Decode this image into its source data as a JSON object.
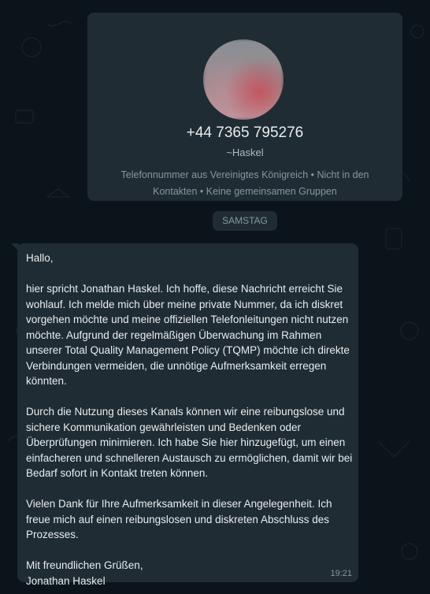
{
  "contact": {
    "phone": "+44 7365 795276",
    "nickname": "~Haskel",
    "info": "Telefonnummer aus Vereinigtes Königreich • Nicht in den Kontakten • Keine gemeinsamen Gruppen"
  },
  "date_chip": "SAMSTAG",
  "message": {
    "greeting": "Hallo,",
    "paragraph1": "hier spricht Jonathan Haskel. Ich hoffe, diese Nachricht erreicht Sie wohlauf. Ich melde mich über meine private Nummer, da ich diskret vorgehen möchte und meine offiziellen Telefonleitungen nicht nutzen möchte. Aufgrund der regelmäßigen Überwachung im Rahmen unserer Total Quality Management Policy (TQMP) möchte ich direkte Verbindungen vermeiden, die unnötige Aufmerksamkeit erregen könnten.",
    "paragraph2": "Durch die Nutzung dieses Kanals können wir eine reibungslose und sichere Kommunikation gewährleisten und Bedenken oder Überprüfungen minimieren. Ich habe Sie hier hinzugefügt, um einen einfacheren und schnelleren Austausch zu ermöglichen, damit wir bei Bedarf sofort in Kontakt treten können.",
    "paragraph3": "Vielen Dank für Ihre Aufmerksamkeit in dieser Angelegenheit. Ich freue mich auf einen reibungslosen und diskreten Abschluss des Prozesses.",
    "closing": "Mit freundlichen Grüßen,",
    "signature": "Jonathan Haskel",
    "time": "19:21"
  },
  "colors": {
    "background": "#0b141a",
    "bubble": "#1f2c33",
    "primary_text": "#e9edef",
    "secondary_text": "#8696a0"
  }
}
